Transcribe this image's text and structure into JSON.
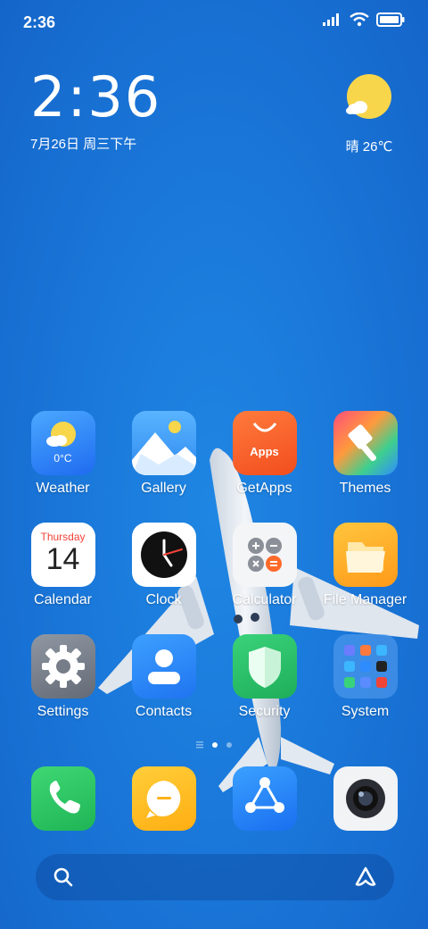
{
  "status": {
    "time": "2:36"
  },
  "clock": {
    "time": "2:36",
    "date": "7月26日 周三下午"
  },
  "weather": {
    "text": "晴 26℃"
  },
  "apps": [
    {
      "label": "Weather",
      "icon": "weather-icon",
      "temp": "0°C"
    },
    {
      "label": "Gallery",
      "icon": "gallery-icon"
    },
    {
      "label": "GetApps",
      "icon": "getapps-icon",
      "badge": "Apps"
    },
    {
      "label": "Themes",
      "icon": "themes-icon"
    },
    {
      "label": "Calendar",
      "icon": "calendar-icon",
      "day": "Thursday",
      "date": "14"
    },
    {
      "label": "Clock",
      "icon": "clock-icon"
    },
    {
      "label": "Calculator",
      "icon": "calculator-icon"
    },
    {
      "label": "File Manager",
      "icon": "file-manager-icon"
    },
    {
      "label": "Settings",
      "icon": "settings-icon"
    },
    {
      "label": "Contacts",
      "icon": "contacts-icon"
    },
    {
      "label": "Security",
      "icon": "security-icon"
    },
    {
      "label": "System",
      "icon": "system-folder-icon"
    }
  ],
  "dock": [
    {
      "icon": "phone-icon"
    },
    {
      "icon": "messages-icon"
    },
    {
      "icon": "share-icon"
    },
    {
      "icon": "camera-icon"
    }
  ],
  "colors": {
    "wallpaper": "#1a78da",
    "weather_sun": "#f7d54a"
  }
}
